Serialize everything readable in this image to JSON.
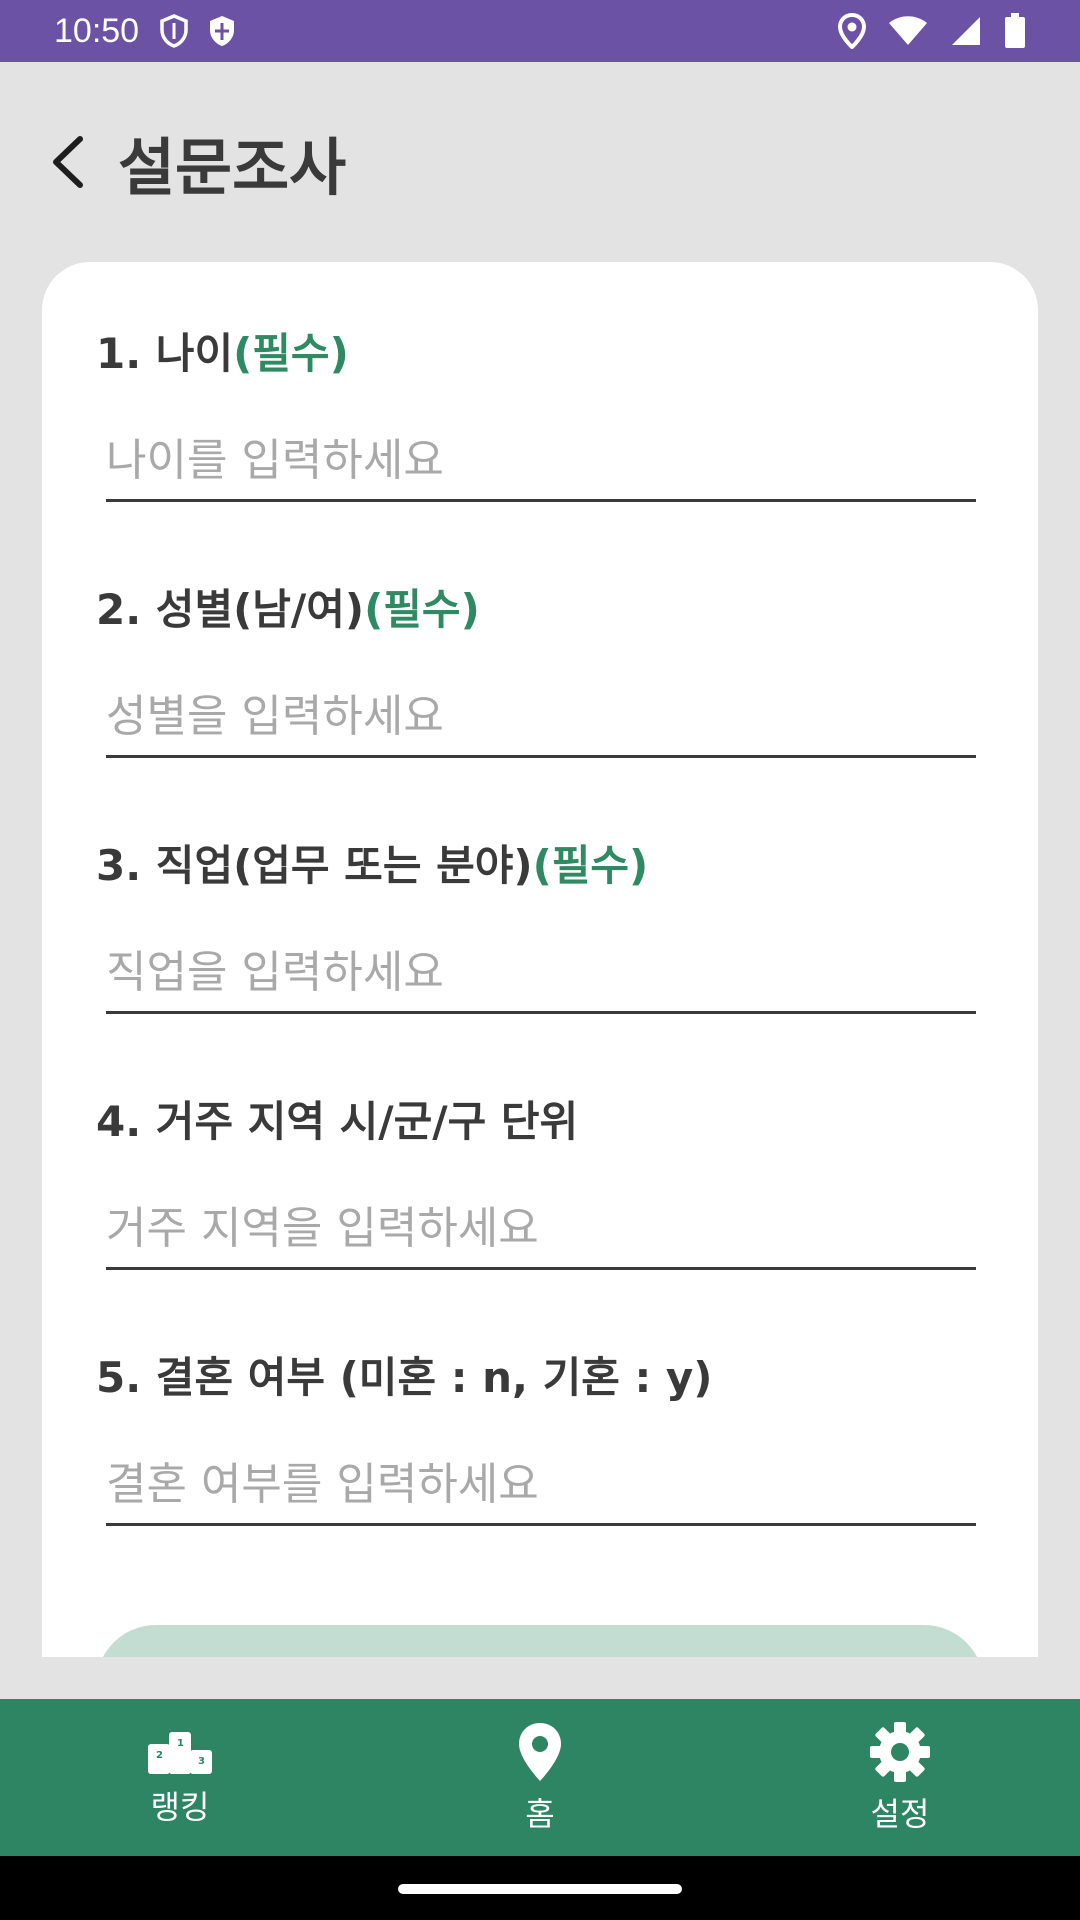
{
  "status_bar": {
    "time": "10:50",
    "left_icons": [
      "shield-outline-icon",
      "security-shield-icon"
    ],
    "right_icons": [
      "location-icon",
      "wifi-icon",
      "cell-signal-icon",
      "battery-icon"
    ]
  },
  "header": {
    "back_icon": "chevron-left-icon",
    "title": "설문조사"
  },
  "questions": [
    {
      "label": "1. 나이",
      "required": "(필수)",
      "placeholder": "나이를 입력하세요",
      "value": ""
    },
    {
      "label": "2. 성별(남/여)",
      "required": "(필수)",
      "placeholder": "성별을 입력하세요",
      "value": ""
    },
    {
      "label": "3. 직업(업무 또는 분야)",
      "required": "(필수)",
      "placeholder": "직업을 입력하세요",
      "value": ""
    },
    {
      "label": "4. 거주 지역 시/군/구 단위",
      "required": "",
      "placeholder": "거주 지역을 입력하세요",
      "value": ""
    },
    {
      "label": "5. 결혼 여부 (미혼 : n, 기혼 : y)",
      "required": "",
      "placeholder": "결혼 여부를 입력하세요",
      "value": ""
    }
  ],
  "bottom_nav": {
    "items": [
      {
        "label": "랭킹",
        "icon": "podium-icon"
      },
      {
        "label": "홈",
        "icon": "location-pin-icon"
      },
      {
        "label": "설정",
        "icon": "gear-icon"
      }
    ]
  },
  "colors": {
    "status_bar": "#6b52a5",
    "accent": "#2e8564",
    "required": "#2e8a63",
    "submit_button": "#c3ddd3"
  }
}
